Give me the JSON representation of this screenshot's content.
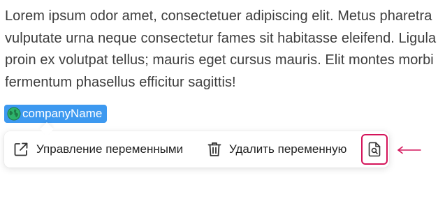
{
  "editor": {
    "line1": "Lorem ipsum odor amet, consectetuer adipiscing elit. Metus pharetra",
    "line2": "vulputate urna neque consectetur fames sit habitasse eleifend. Ligula",
    "line3": "proin ex volutpat tellus; mauris eget cursus mauris. Elit montes morbi",
    "line4": "fermentum phasellus efficitur sagittis!"
  },
  "variable_chip": {
    "label": "companyName",
    "icon": "globe-icon",
    "color": "#3d99f0"
  },
  "popup": {
    "manage_label": "Управление переменными",
    "manage_icon": "external-link-icon",
    "delete_label": "Удалить переменную",
    "delete_icon": "trash-icon",
    "preview_icon": "file-search-icon",
    "highlight_color": "#d4145a"
  },
  "annotation": {
    "arrow_icon": "left-arrow-icon",
    "color": "#d4145a"
  }
}
